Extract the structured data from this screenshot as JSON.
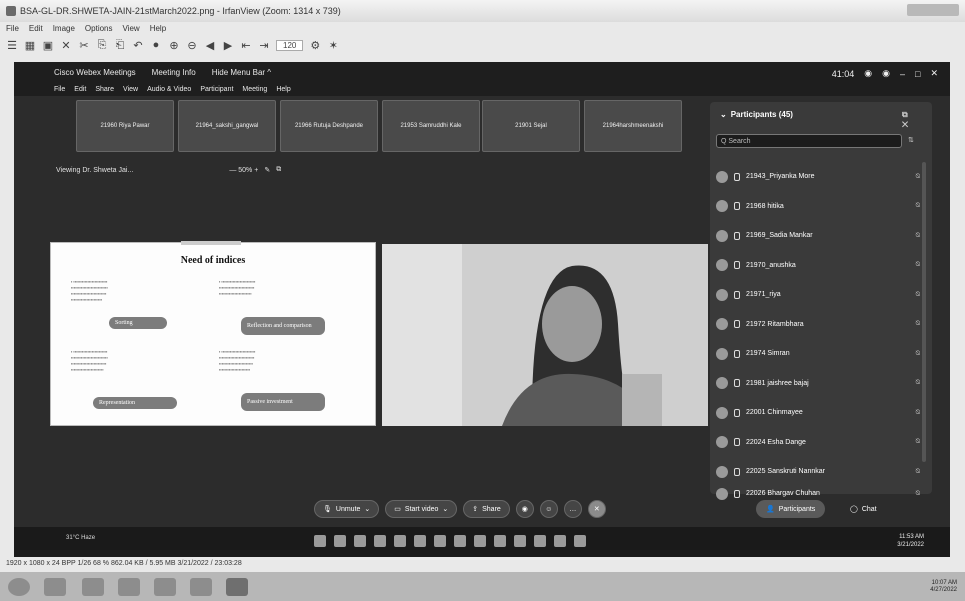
{
  "viewer": {
    "title": "BSA-GL-DR.SHWETA-JAIN-21stMarch2022.png - IrfanView (Zoom: 1314 x 739)",
    "menu": [
      "File",
      "Edit",
      "Image",
      "Options",
      "View",
      "Help"
    ],
    "zoom_value": "120"
  },
  "webex": {
    "title_items": [
      "Cisco Webex Meetings",
      "Meeting Info",
      "Hide Menu Bar ^"
    ],
    "menu": [
      "File",
      "Edit",
      "Share",
      "View",
      "Audio & Video",
      "Participant",
      "Meeting",
      "Help"
    ],
    "time": "41:04"
  },
  "tiles": [
    "21960 Riya Pawar",
    "21964_sakshi_gangwal",
    "21966 Rutuja Deshpande",
    "21953 Samruddhi Kale",
    "21901 Sejal",
    "21964harshmeenakshi"
  ],
  "viewing": {
    "label": "Viewing Dr. Shweta Jai...",
    "zoom": "— 50% +"
  },
  "slide": {
    "title": "Need of indices",
    "buttons": [
      "Sorting",
      "Reflection and comparison",
      "Representation",
      "Passive investment"
    ]
  },
  "participants": {
    "header": "Participants (45)",
    "search_placeholder": "Q Search",
    "list": [
      "21943_Priyanka More",
      "21968 hitika",
      "21969_Sadia Mankar",
      "21970_anushka",
      "21971_riya",
      "21972 Ritambhara",
      "21974 Simran",
      "21981 jaishree bajaj",
      "22001 Chinmayee",
      "22024 Esha Dange",
      "22025 Sanskruti Nannkar",
      "22026 Bhargav Chuhan"
    ]
  },
  "controls": {
    "unmute": "Unmute",
    "start_video": "Start video",
    "share": "Share",
    "participants": "Participants",
    "chat": "Chat"
  },
  "taskbar": {
    "weather": "31°C Haze",
    "time": "11:53 AM",
    "date": "3/21/2022"
  },
  "status": "1920 x 1080 x 24 BPP   1/26   68 %   862.04 KB / 5.95 MB   3/21/2022 / 23:03:28",
  "bottom": {
    "time": "10:07 AM",
    "date": "4/27/2022"
  }
}
